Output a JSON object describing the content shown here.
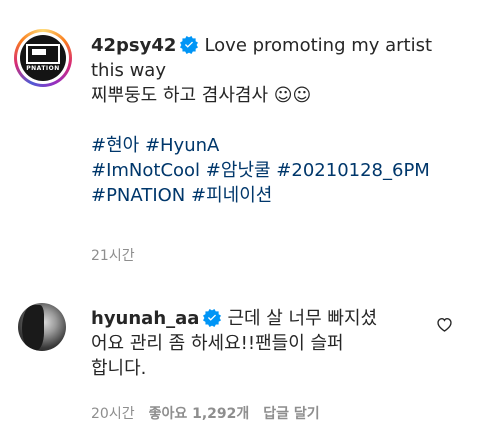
{
  "post": {
    "username": "42psy42",
    "caption_line1": "Love promoting my artist",
    "caption_line2": "this way",
    "caption_line3": "찌뿌둥도 하고 겸사겸사 ☺☺",
    "hashtags_line1": [
      "#현아",
      "#HyunA"
    ],
    "hashtags_line2": [
      "#ImNotCool",
      "#암낫쿨",
      "#20210128_6PM"
    ],
    "hashtags_line3": [
      "#PNATION",
      "#피네이션"
    ],
    "time": "21시간",
    "avatar_logo_text": "PNATION"
  },
  "comment": {
    "username": "hyunah_aa",
    "text_line1": "근데 살 너무 빠지셨",
    "text_line2": "어요 관리 좀 하세요!!팬들이 슬퍼",
    "text_line3": "합니다.",
    "time": "20시간",
    "likes": "좋아요 1,292개",
    "reply": "답글 달기"
  },
  "colors": {
    "text": "#262626",
    "link": "#00376b",
    "meta": "#8e8e8e",
    "verified": "#0095f6"
  }
}
